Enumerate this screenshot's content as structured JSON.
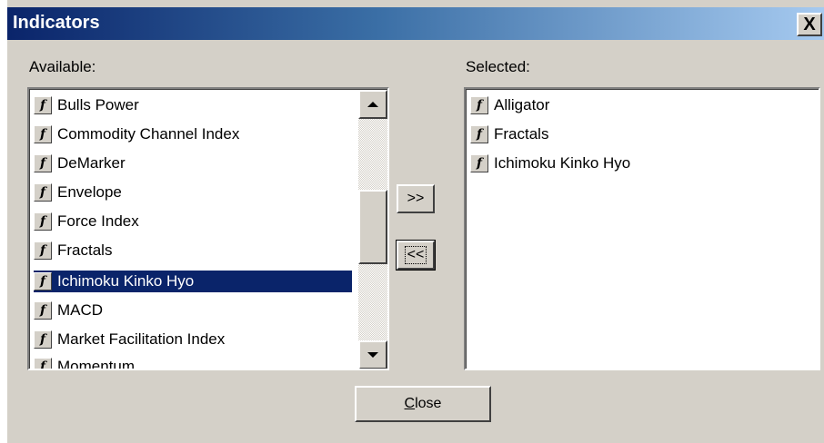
{
  "window": {
    "title": "Indicators",
    "close_glyph": "X"
  },
  "available": {
    "label": "Available:",
    "items": [
      {
        "label": "Bulls Power",
        "icon": "function-icon",
        "selected": false
      },
      {
        "label": "Commodity Channel Index",
        "icon": "function-icon",
        "selected": false
      },
      {
        "label": "DeMarker",
        "icon": "function-icon",
        "selected": false
      },
      {
        "label": "Envelope",
        "icon": "function-icon",
        "selected": false
      },
      {
        "label": "Force Index",
        "icon": "function-icon",
        "selected": false
      },
      {
        "label": "Fractals",
        "icon": "function-icon",
        "selected": false
      },
      {
        "label": "Ichimoku Kinko Hyo",
        "icon": "function-icon",
        "selected": true
      },
      {
        "label": "MACD",
        "icon": "function-icon",
        "selected": false
      },
      {
        "label": "Market Facilitation Index",
        "icon": "function-icon",
        "selected": false
      },
      {
        "label": "Momentum",
        "icon": "function-icon",
        "selected": false
      }
    ]
  },
  "selected": {
    "label": "Selected:",
    "items": [
      {
        "label": "Alligator",
        "icon": "function-icon"
      },
      {
        "label": "Fractals",
        "icon": "function-icon"
      },
      {
        "label": "Ichimoku Kinko Hyo",
        "icon": "function-icon"
      }
    ]
  },
  "buttons": {
    "add": ">>",
    "remove": "<<",
    "close": "Close"
  },
  "icon_glyph": "f",
  "colors": {
    "title_start": "#0a246a",
    "title_end": "#a6caf0",
    "selection": "#0a246a",
    "face": "#d4d0c8"
  }
}
